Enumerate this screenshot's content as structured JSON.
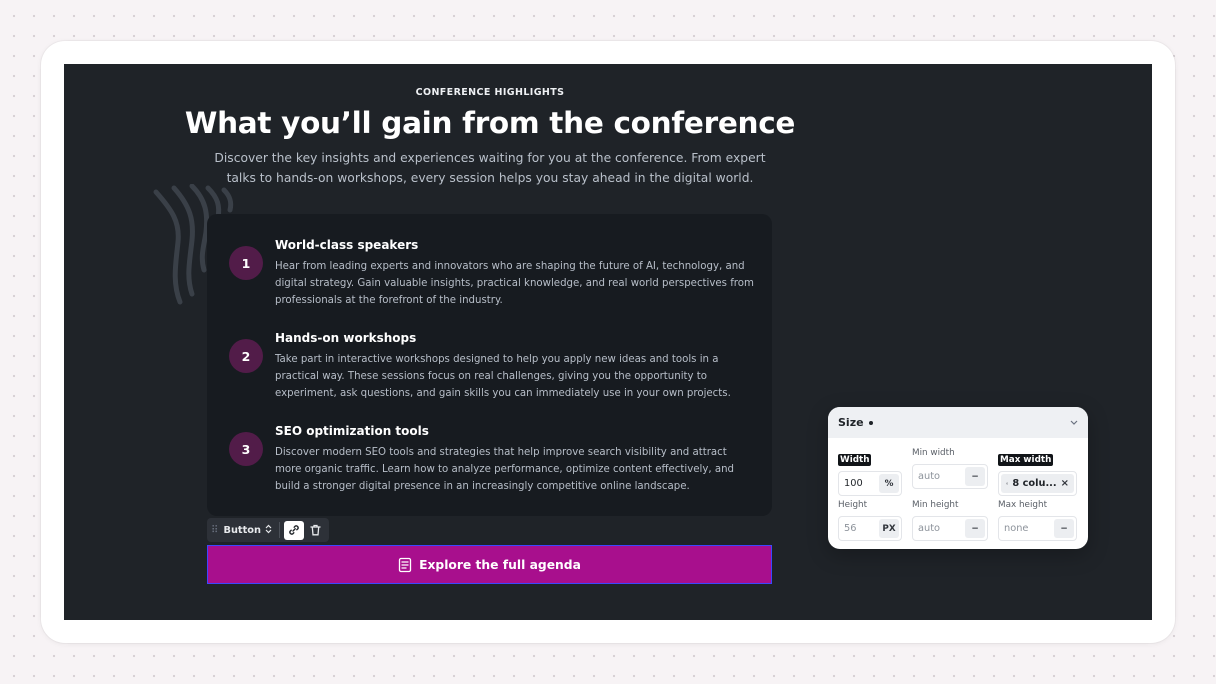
{
  "section": {
    "eyebrow": "CONFERENCE HIGHLIGHTS",
    "headline": "What you’ll gain from the conference",
    "lead": "Discover the key insights and experiences waiting for you at the conference. From expert talks to hands-on workshops, every session helps you stay ahead in the digital world."
  },
  "items": [
    {
      "number": "1",
      "title": "World-class speakers",
      "description": "Hear from leading experts and innovators who are shaping the future of AI, technology, and digital strategy. Gain valuable insights, practical knowledge, and real world perspectives from professionals at the forefront of the industry."
    },
    {
      "number": "2",
      "title": "Hands-on workshops",
      "description": "Take part in interactive workshops designed to help you apply new ideas and tools in a practical way. These sessions focus on real challenges, giving you the opportunity to experiment, ask questions, and gain skills you can immediately use in your own projects."
    },
    {
      "number": "3",
      "title": "SEO optimization tools",
      "description": "Discover modern SEO tools and strategies that help improve search visibility and attract more organic traffic. Learn how to analyze performance, optimize content effectively, and build a stronger digital presence in an increasingly competitive online landscape."
    }
  ],
  "toolbar": {
    "element_label": "Button",
    "icons": [
      "drag-handle-icon",
      "chevron-updown-icon",
      "link-icon",
      "trash-icon"
    ]
  },
  "cta": {
    "label": "Explore the full agenda",
    "icon": "agenda-icon"
  },
  "size_panel": {
    "title": "Size",
    "fields": {
      "width": {
        "label": "Width",
        "value": "100",
        "unit": "%"
      },
      "min_width": {
        "label": "Min width",
        "value": "auto",
        "unit": "−"
      },
      "max_width": {
        "label": "Max width",
        "value": "8 colu...",
        "unit": "×"
      },
      "height": {
        "label": "Height",
        "value": "56",
        "unit": "PX"
      },
      "min_height": {
        "label": "Min height",
        "value": "auto",
        "unit": "−"
      },
      "max_height": {
        "label": "Max height",
        "value": "none",
        "unit": "−"
      }
    }
  },
  "colors": {
    "canvas_bg": "#1f2328",
    "card_bg": "#171b20",
    "badge_bg": "#521c49",
    "cta_bg": "#a80f8d",
    "selection_outline": "#3d47ff"
  }
}
